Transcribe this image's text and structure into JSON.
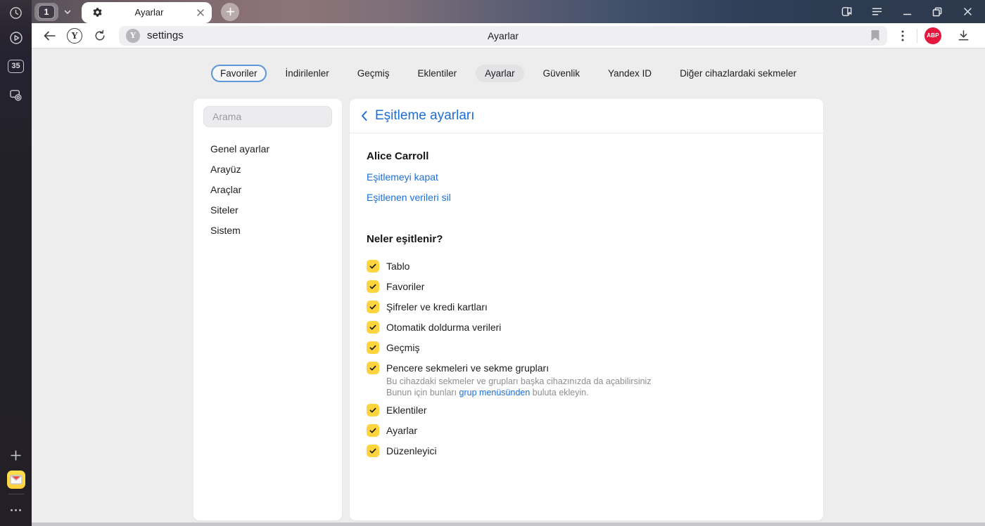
{
  "rail": {
    "badge_label": "35"
  },
  "titlebar": {
    "tab_counter": "1",
    "active_tab_title": "Ayarlar"
  },
  "addressbar": {
    "url_text": "settings",
    "center_title": "Ayarlar",
    "abp_label": "ABP"
  },
  "nav_tabs": {
    "items": [
      "Favoriler",
      "İndirilenler",
      "Geçmiş",
      "Eklentiler",
      "Ayarlar",
      "Güvenlik",
      "Yandex ID",
      "Diğer cihazlardaki sekmeler"
    ]
  },
  "settings_nav": {
    "search_placeholder": "Arama",
    "items": [
      "Genel ayarlar",
      "Arayüz",
      "Araçlar",
      "Siteler",
      "Sistem"
    ]
  },
  "sync": {
    "title": "Eşitleme ayarları",
    "account_name": "Alice Carroll",
    "link_disable": "Eşitlemeyi kapat",
    "link_delete": "Eşitlenen verileri sil",
    "section_title": "Neler eşitlenir?",
    "items": [
      {
        "label": "Tablo",
        "checked": true
      },
      {
        "label": "Favoriler",
        "checked": true
      },
      {
        "label": "Şifreler ve kredi kartları",
        "checked": true
      },
      {
        "label": "Otomatik doldurma verileri",
        "checked": true
      },
      {
        "label": "Geçmiş",
        "checked": true
      },
      {
        "label": "Pencere sekmeleri ve sekme grupları",
        "checked": true
      },
      {
        "label": "Eklentiler",
        "checked": true
      },
      {
        "label": "Ayarlar",
        "checked": true
      },
      {
        "label": "Düzenleyici",
        "checked": true
      }
    ],
    "tab_groups_note": {
      "line1": "Bu cihazdaki sekmeler ve grupları başka cihazınızda da açabilirsiniz",
      "line2_prefix": "Bunun için bunları ",
      "line2_link": "grup menüsünden",
      "line2_suffix": " buluta ekleyin."
    }
  },
  "colors": {
    "accent_blue": "#1a6fd8",
    "checkbox_yellow": "#ffd53e",
    "abp_red": "#e5173f",
    "titlebar_navy": "#2d3a4e",
    "page_bg": "#eeedee"
  }
}
